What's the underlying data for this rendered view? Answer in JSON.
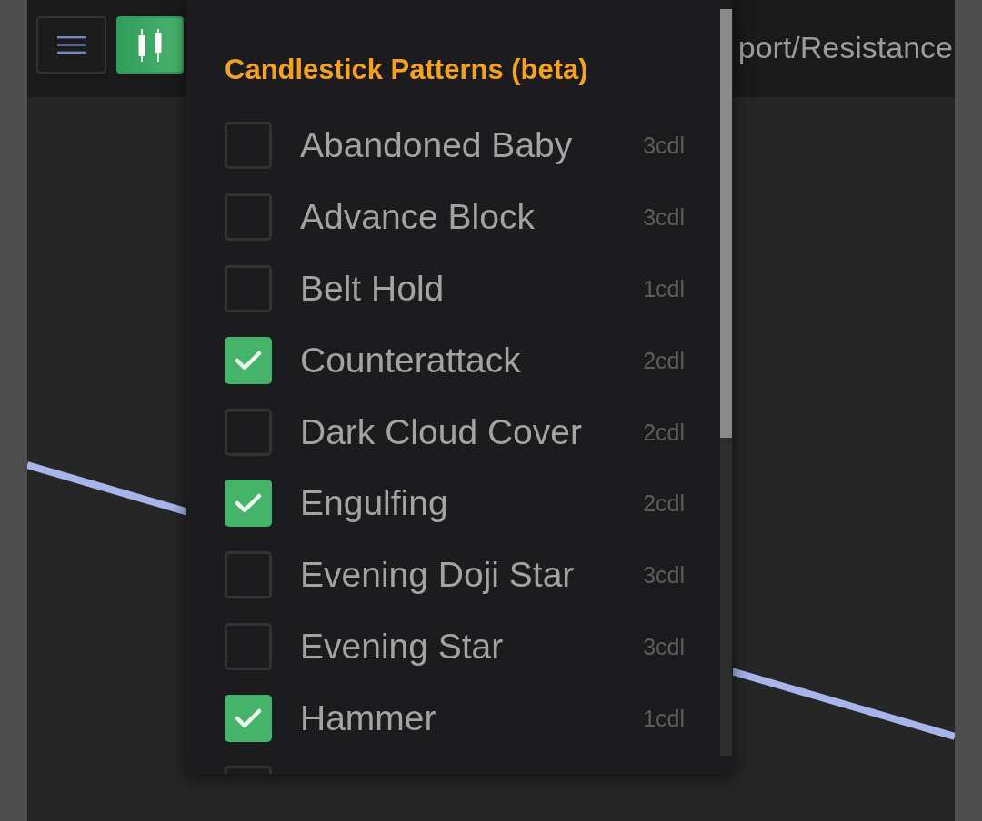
{
  "toolbar": {
    "buttons": [
      {
        "kind": "menu",
        "active": false
      },
      {
        "kind": "candlestick",
        "active": true
      }
    ],
    "label": "port/Resistance"
  },
  "pattern_menu": {
    "title": "Candlestick Patterns (beta)",
    "patterns": [
      {
        "name": "Abandoned Baby",
        "candles": "3cdl",
        "checked": false
      },
      {
        "name": "Advance Block",
        "candles": "3cdl",
        "checked": false
      },
      {
        "name": "Belt Hold",
        "candles": "1cdl",
        "checked": false
      },
      {
        "name": "Counterattack",
        "candles": "2cdl",
        "checked": true
      },
      {
        "name": "Dark Cloud Cover",
        "candles": "2cdl",
        "checked": false
      },
      {
        "name": "Engulfing",
        "candles": "2cdl",
        "checked": true
      },
      {
        "name": "Evening Doji Star",
        "candles": "3cdl",
        "checked": false
      },
      {
        "name": "Evening Star",
        "candles": "3cdl",
        "checked": false
      },
      {
        "name": "Hammer",
        "candles": "1cdl",
        "checked": true
      }
    ],
    "partial_row": {
      "checked": false
    }
  }
}
